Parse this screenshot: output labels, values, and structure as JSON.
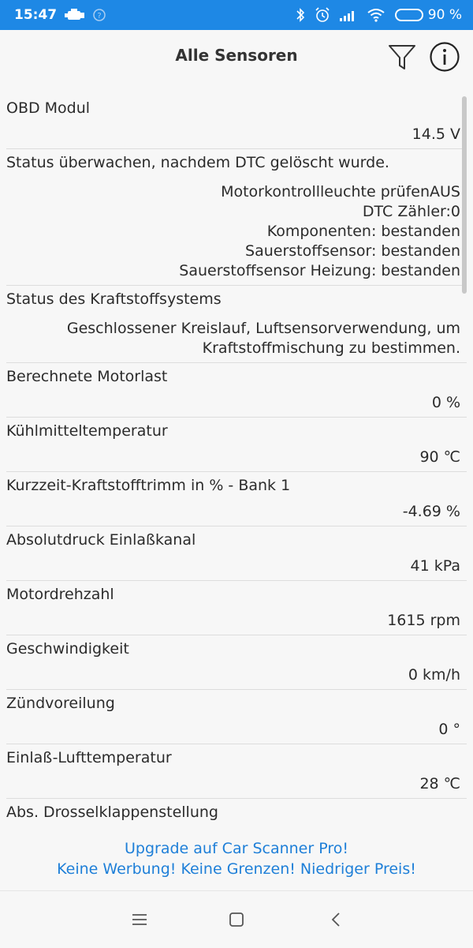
{
  "status_bar": {
    "time": "15:47",
    "battery_percent": "90 %",
    "battery_level": 0.9
  },
  "header": {
    "title": "Alle Sensoren"
  },
  "sensors": [
    {
      "name": "OBD Modul",
      "values": [
        "14.5  V"
      ]
    },
    {
      "name": "Status überwachen, nachdem DTC gelöscht wurde.",
      "values": [
        "Motorkontrollleuchte prüfenAUS",
        "DTC Zähler:0",
        "Komponenten: bestanden",
        "Sauerstoffsensor: bestanden",
        "Sauerstoffsensor Heizung: bestanden"
      ]
    },
    {
      "name": "Status des Kraftstoffsystems",
      "values": [
        "Geschlossener Kreislauf, Luftsensorverwendung, um",
        "Kraftstoffmischung zu bestimmen."
      ]
    },
    {
      "name": "Berechnete Motorlast",
      "values": [
        "0  %"
      ]
    },
    {
      "name": "Kühlmitteltemperatur",
      "values": [
        "90  ℃"
      ]
    },
    {
      "name": "Kurzzeit-Kraftstofftrimm in % - Bank 1",
      "values": [
        "-4.69  %"
      ]
    },
    {
      "name": "Absolutdruck Einlaßkanal",
      "values": [
        "41  kPa"
      ]
    },
    {
      "name": "Motordrehzahl",
      "values": [
        "1615  rpm"
      ]
    },
    {
      "name": "Geschwindigkeit",
      "values": [
        "0  km/h"
      ]
    },
    {
      "name": "Zündvoreilung",
      "values": [
        "0  °"
      ]
    },
    {
      "name": "Einlaß-Lufttemperatur",
      "values": [
        "28  ℃"
      ]
    },
    {
      "name": "Abs. Drosselklappenstellung",
      "values": []
    }
  ],
  "upgrade_banner": {
    "line1": "Upgrade auf Car Scanner Pro!",
    "line2": "Keine Werbung! Keine Grenzen! Niedriger Preis!"
  },
  "colors": {
    "status_bar_bg": "#1e88e5",
    "link": "#1e7fd8",
    "background": "#f7f7f7"
  }
}
